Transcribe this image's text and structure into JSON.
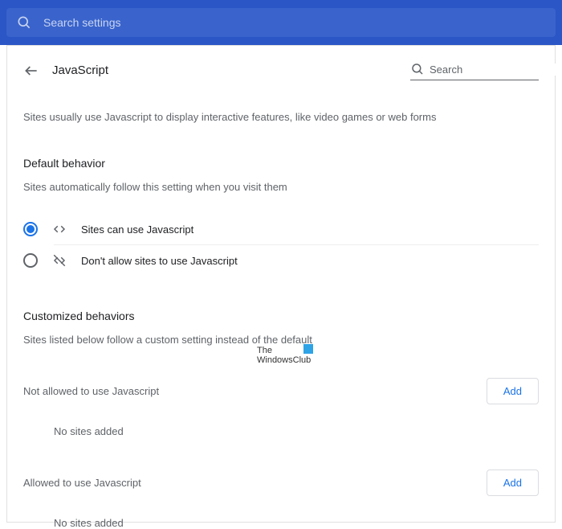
{
  "topSearch": {
    "placeholder": "Search settings"
  },
  "header": {
    "title": "JavaScript",
    "searchPlaceholder": "Search"
  },
  "intro": "Sites usually use Javascript to display interactive features, like video games or web forms",
  "defaultBehavior": {
    "title": "Default behavior",
    "subtitle": "Sites automatically follow this setting when you visit them",
    "options": [
      {
        "label": "Sites can use Javascript",
        "selected": true
      },
      {
        "label": "Don't allow sites to use Javascript",
        "selected": false
      }
    ]
  },
  "customized": {
    "title": "Customized behaviors",
    "subtitle": "Sites listed below follow a custom setting instead of the default"
  },
  "notAllowed": {
    "label": "Not allowed to use Javascript",
    "addLabel": "Add",
    "empty": "No sites added"
  },
  "allowed": {
    "label": "Allowed to use Javascript",
    "addLabel": "Add",
    "empty": "No sites added"
  },
  "watermark": {
    "line1": "The",
    "line2": "WindowsClub"
  }
}
